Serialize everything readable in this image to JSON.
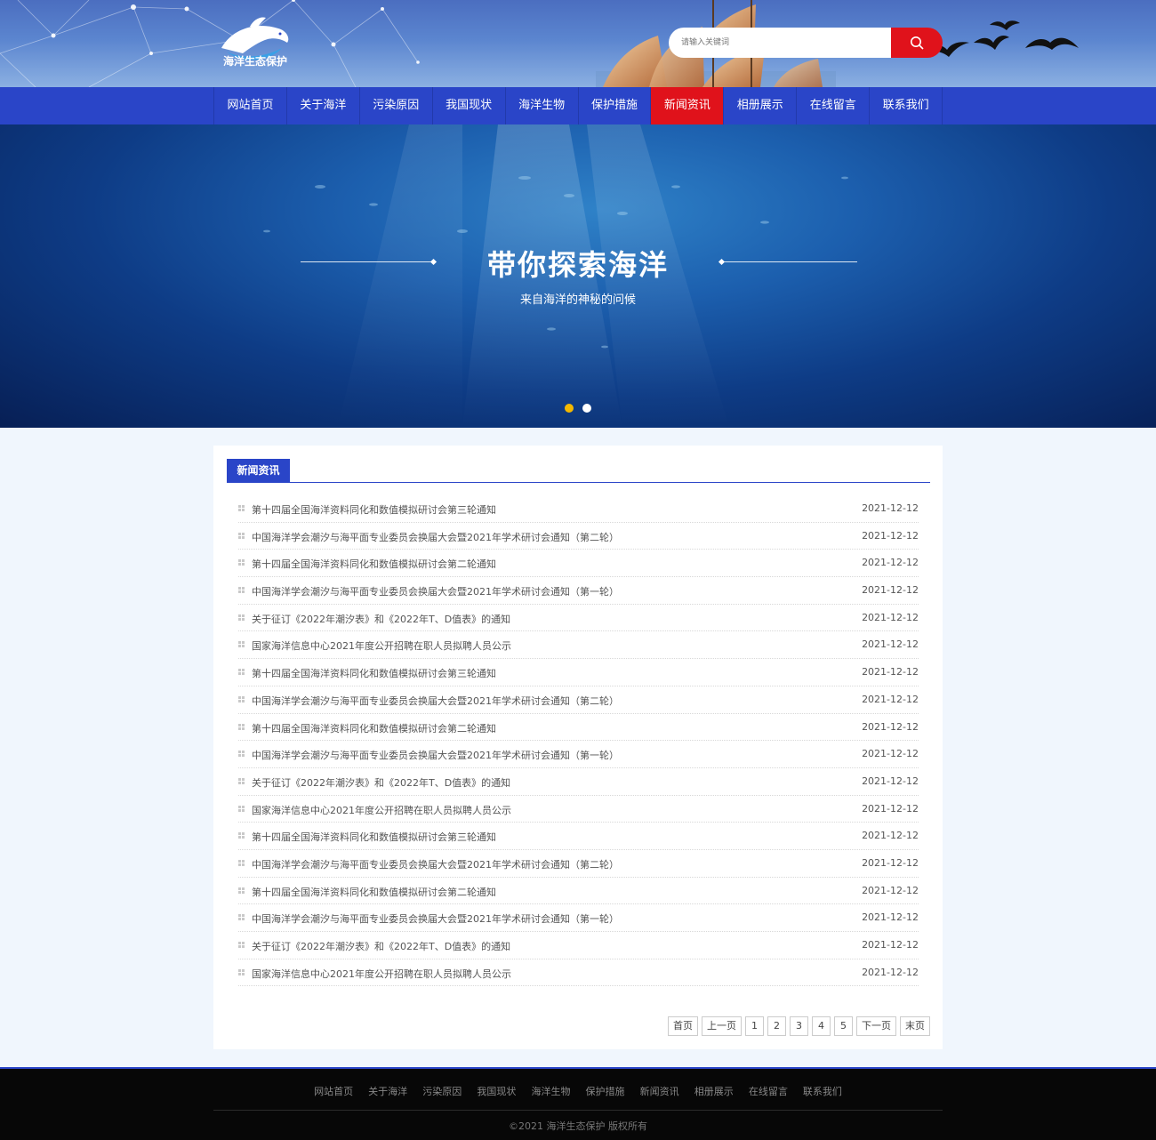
{
  "header": {
    "logo_text": "海洋生态保护",
    "logo_icon": "dolphin-icon",
    "search": {
      "placeholder": "请输入关键词",
      "button_icon": "search-icon"
    }
  },
  "nav": {
    "items": [
      {
        "label": "网站首页"
      },
      {
        "label": "关于海洋"
      },
      {
        "label": "污染原因"
      },
      {
        "label": "我国现状"
      },
      {
        "label": "海洋生物"
      },
      {
        "label": "保护措施"
      },
      {
        "label": "新闻资讯",
        "active": true
      },
      {
        "label": "相册展示"
      },
      {
        "label": "在线留言"
      },
      {
        "label": "联系我们"
      }
    ]
  },
  "banner": {
    "title": "带你探索海洋",
    "subtitle": "来自海洋的神秘的问候",
    "active_slide": 1,
    "slide_count": 2
  },
  "news": {
    "section_title": "新闻资讯",
    "items": [
      {
        "title": "第十四届全国海洋资料同化和数值模拟研讨会第三轮通知",
        "date": "2021-12-12"
      },
      {
        "title": "中国海洋学会潮汐与海平面专业委员会换届大会暨2021年学术研讨会通知（第二轮）",
        "date": "2021-12-12"
      },
      {
        "title": "第十四届全国海洋资料同化和数值模拟研讨会第二轮通知",
        "date": "2021-12-12"
      },
      {
        "title": "中国海洋学会潮汐与海平面专业委员会换届大会暨2021年学术研讨会通知（第一轮）",
        "date": "2021-12-12"
      },
      {
        "title": "关于征订《2022年潮汐表》和《2022年T、D值表》的通知",
        "date": "2021-12-12"
      },
      {
        "title": "国家海洋信息中心2021年度公开招聘在职人员拟聘人员公示",
        "date": "2021-12-12"
      },
      {
        "title": "第十四届全国海洋资料同化和数值模拟研讨会第三轮通知",
        "date": "2021-12-12"
      },
      {
        "title": "中国海洋学会潮汐与海平面专业委员会换届大会暨2021年学术研讨会通知（第二轮）",
        "date": "2021-12-12"
      },
      {
        "title": "第十四届全国海洋资料同化和数值模拟研讨会第二轮通知",
        "date": "2021-12-12"
      },
      {
        "title": "中国海洋学会潮汐与海平面专业委员会换届大会暨2021年学术研讨会通知（第一轮）",
        "date": "2021-12-12"
      },
      {
        "title": "关于征订《2022年潮汐表》和《2022年T、D值表》的通知",
        "date": "2021-12-12"
      },
      {
        "title": "国家海洋信息中心2021年度公开招聘在职人员拟聘人员公示",
        "date": "2021-12-12"
      },
      {
        "title": "第十四届全国海洋资料同化和数值模拟研讨会第三轮通知",
        "date": "2021-12-12"
      },
      {
        "title": "中国海洋学会潮汐与海平面专业委员会换届大会暨2021年学术研讨会通知（第二轮）",
        "date": "2021-12-12"
      },
      {
        "title": "第十四届全国海洋资料同化和数值模拟研讨会第二轮通知",
        "date": "2021-12-12"
      },
      {
        "title": "中国海洋学会潮汐与海平面专业委员会换届大会暨2021年学术研讨会通知（第一轮）",
        "date": "2021-12-12"
      },
      {
        "title": "关于征订《2022年潮汐表》和《2022年T、D值表》的通知",
        "date": "2021-12-12"
      },
      {
        "title": "国家海洋信息中心2021年度公开招聘在职人员拟聘人员公示",
        "date": "2021-12-12"
      }
    ]
  },
  "pager": {
    "items": [
      "首页",
      "上一页",
      "1",
      "2",
      "3",
      "4",
      "5",
      "下一页",
      "末页"
    ]
  },
  "footer": {
    "links": [
      "网站首页",
      "关于海洋",
      "污染原因",
      "我国现状",
      "海洋生物",
      "保护措施",
      "新闻资讯",
      "相册展示",
      "在线留言",
      "联系我们"
    ],
    "copyright": "©2021 海洋生态保护 版权所有"
  },
  "colors": {
    "nav_blue": "#2a45c8",
    "active_red": "#e0121b",
    "slide_dot_active": "#f4b800"
  }
}
